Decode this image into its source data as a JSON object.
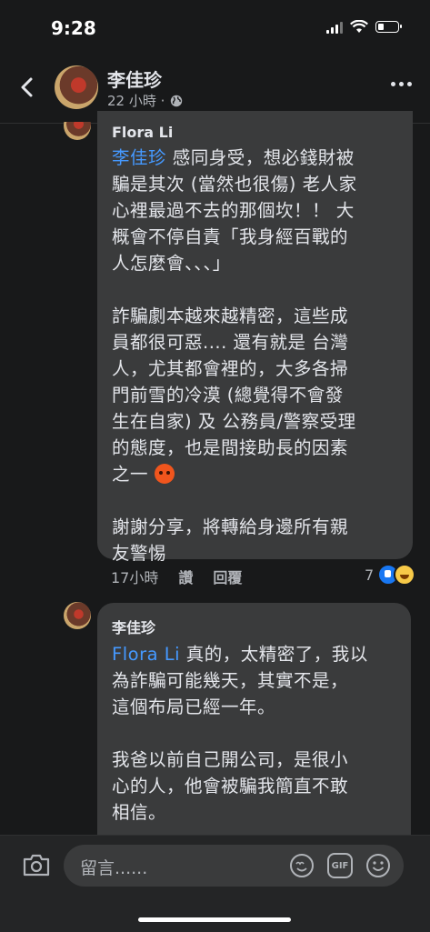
{
  "status_bar": {
    "time": "9:28"
  },
  "header": {
    "name": "李佳珍",
    "timestamp": "22 小時 ·"
  },
  "comment1": {
    "author": "Flora Li",
    "mention": "李佳珍",
    "text_after_mention": " 感同身受，想必錢財被\n騙是其次 (當然也很傷) 老人家\n心裡最過不去的那個坎！！ 大\n概會不停自責「我身經百戰的\n人怎麼會、、、」\n\n詐騙劇本越來越精密，這些成\n員都很可惡.... 還有就是 台灣\n人，尤其都會裡的，大多各掃\n門前雪的冷漠 (總覺得不會發\n生在自家) 及 公務員/警察受理\n的態度，也是間接助長的因素\n之一 ",
    "text_after_emoji": "\n\n謝謝分享，將轉給身邊所有親\n友警惕",
    "time": "17小時",
    "like_label": "讚",
    "reply_label": "回覆",
    "reaction_count": "7"
  },
  "comment2": {
    "author": "李佳珍",
    "mention": "Flora Li",
    "text_after_mention": " 真的，太精密了，我以\n為詐騙可能幾天，其實不是，\n這個布局已經一年。\n\n我爸以前自己開公司，是很小\n心的人，他會被騙我簡直不敢\n相信。"
  },
  "composer": {
    "placeholder": "留言......",
    "gif_label": "GIF"
  }
}
